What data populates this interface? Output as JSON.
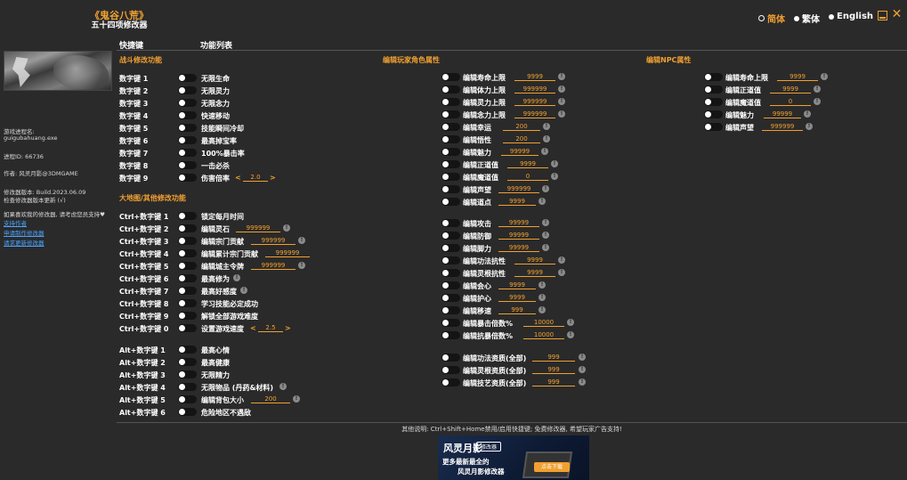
{
  "header": {
    "title": "《鬼谷八荒》",
    "subtitle": "五十四项修改器",
    "languages": [
      "简体",
      "繁体",
      "English"
    ],
    "minimize_icon": "minimize-icon",
    "close_icon": "close-icon",
    "close_glyph": "✕"
  },
  "columns": {
    "hotkey": "快捷键",
    "features": "功能列表"
  },
  "sidebar": {
    "process_label": "游戏进程名:",
    "process_name": "guigubahuang.exe",
    "pid": "进程ID:  66736",
    "author": "作者:  风灵月影@3DMGAME",
    "version": "修改器版本:  Build.2023.06.09",
    "check_update": "检查修改器版本更新 (√)",
    "support_text": "如果喜欢我的修改器, 请考虑您员支持♥",
    "links": [
      "支持作者",
      "申请制作修改器",
      "请求更新修改器"
    ]
  },
  "sections": {
    "combat": "战斗修改功能",
    "map": "大地图/其他修改功能",
    "player": "编辑玩家角色属性",
    "npc": "编辑NPC属性"
  },
  "combat_rows": [
    {
      "key": "数字键 1",
      "label": "无限生命"
    },
    {
      "key": "数字键 2",
      "label": "无限灵力"
    },
    {
      "key": "数字键 3",
      "label": "无限念力"
    },
    {
      "key": "数字键 4",
      "label": "快速移动"
    },
    {
      "key": "数字键 5",
      "label": "技能瞬间冷却"
    },
    {
      "key": "数字键 6",
      "label": "最高掉宝率"
    },
    {
      "key": "数字键 7",
      "label": "100%暴击率"
    },
    {
      "key": "数字键 8",
      "label": "一击必杀"
    },
    {
      "key": "数字键 9",
      "label": "伤害倍率",
      "value": "2.0"
    }
  ],
  "map_rows": [
    {
      "key": "Ctrl+数字键 1",
      "label": "锁定每月时间"
    },
    {
      "key": "Ctrl+数字键 2",
      "label": "编辑灵石",
      "value": "999999"
    },
    {
      "key": "Ctrl+数字键 3",
      "label": "编辑宗门贡献",
      "value": "999999"
    },
    {
      "key": "Ctrl+数字键 4",
      "label": "编辑累计宗门贡献",
      "value": "999999"
    },
    {
      "key": "Ctrl+数字键 5",
      "label": "编辑城主令牌",
      "value": "999999"
    },
    {
      "key": "Ctrl+数字键 6",
      "label": "最高修为"
    },
    {
      "key": "Ctrl+数字键 7",
      "label": "最高好感度"
    },
    {
      "key": "Ctrl+数字键 8",
      "label": "学习技能必定成功"
    },
    {
      "key": "Ctrl+数字键 9",
      "label": "解锁全部游戏难度"
    },
    {
      "key": "Ctrl+数字键 0",
      "label": "设置游戏速度",
      "value": "2.5"
    }
  ],
  "alt_rows": [
    {
      "key": "Alt+数字键 1",
      "label": "最高心情"
    },
    {
      "key": "Alt+数字键 2",
      "label": "最高健康"
    },
    {
      "key": "Alt+数字键 3",
      "label": "无限精力"
    },
    {
      "key": "Alt+数字键 4",
      "label": "无限物品 (丹药&材料)"
    },
    {
      "key": "Alt+数字键 5",
      "label": "编辑背包大小",
      "value": "200"
    },
    {
      "key": "Alt+数字键 6",
      "label": "危险地区不遇敌"
    }
  ],
  "player_rows": [
    {
      "label": "编辑寿命上限",
      "value": "9999"
    },
    {
      "label": "编辑体力上限",
      "value": "999999"
    },
    {
      "label": "编辑灵力上限",
      "value": "999999"
    },
    {
      "label": "编辑念力上限",
      "value": "999999"
    },
    {
      "label": "编辑幸运",
      "value": "200"
    },
    {
      "label": "编辑悟性",
      "value": "200"
    },
    {
      "label": "编辑魅力",
      "value": "99999"
    },
    {
      "label": "编辑正道值",
      "value": "9999"
    },
    {
      "label": "编辑魔道值",
      "value": "0"
    },
    {
      "label": "编辑声望",
      "value": "999999"
    },
    {
      "label": "编辑道点",
      "value": "9999"
    },
    {
      "label": "编辑攻击",
      "value": "99999"
    },
    {
      "label": "编辑防御",
      "value": "99999"
    },
    {
      "label": "编辑脚力",
      "value": "99999"
    },
    {
      "label": "编辑功法抗性",
      "value": "9999"
    },
    {
      "label": "编辑灵根抗性",
      "value": "9999"
    },
    {
      "label": "编辑会心",
      "value": "9999"
    },
    {
      "label": "编辑护心",
      "value": "9999"
    },
    {
      "label": "编辑移速",
      "value": "999"
    },
    {
      "label": "编辑暴击倍数%",
      "value": "10000"
    },
    {
      "label": "编辑抗暴倍数%",
      "value": "10000"
    },
    {
      "label": "编辑功法资质(全部)",
      "value": "999"
    },
    {
      "label": "编辑灵根资质(全部)",
      "value": "999"
    },
    {
      "label": "编辑技艺资质(全部)",
      "value": "999"
    }
  ],
  "npc_rows": [
    {
      "label": "编辑寿命上限",
      "value": "9999"
    },
    {
      "label": "编辑正道值",
      "value": "9999"
    },
    {
      "label": "编辑魔道值",
      "value": "0"
    },
    {
      "label": "编辑魅力",
      "value": "99999"
    },
    {
      "label": "编辑声望",
      "value": "999999"
    }
  ],
  "glyphs": {
    "left_arrow": "<",
    "right_arrow": ">",
    "info": "!"
  },
  "footer": {
    "text": "其他说明: Ctrl+Shift+Home禁用/启用快捷键; 免费修改器, 希望玩家广告支持!",
    "ad_logo": "风灵月影",
    "ad_badge": "修改器",
    "ad_line1": "更多最新最全的",
    "ad_line2": "风灵月影修改器",
    "ad_button": "点击下载"
  },
  "colors": {
    "accent": "#f0a030",
    "background": "#2a2a2a",
    "link": "#4aa3ff"
  }
}
